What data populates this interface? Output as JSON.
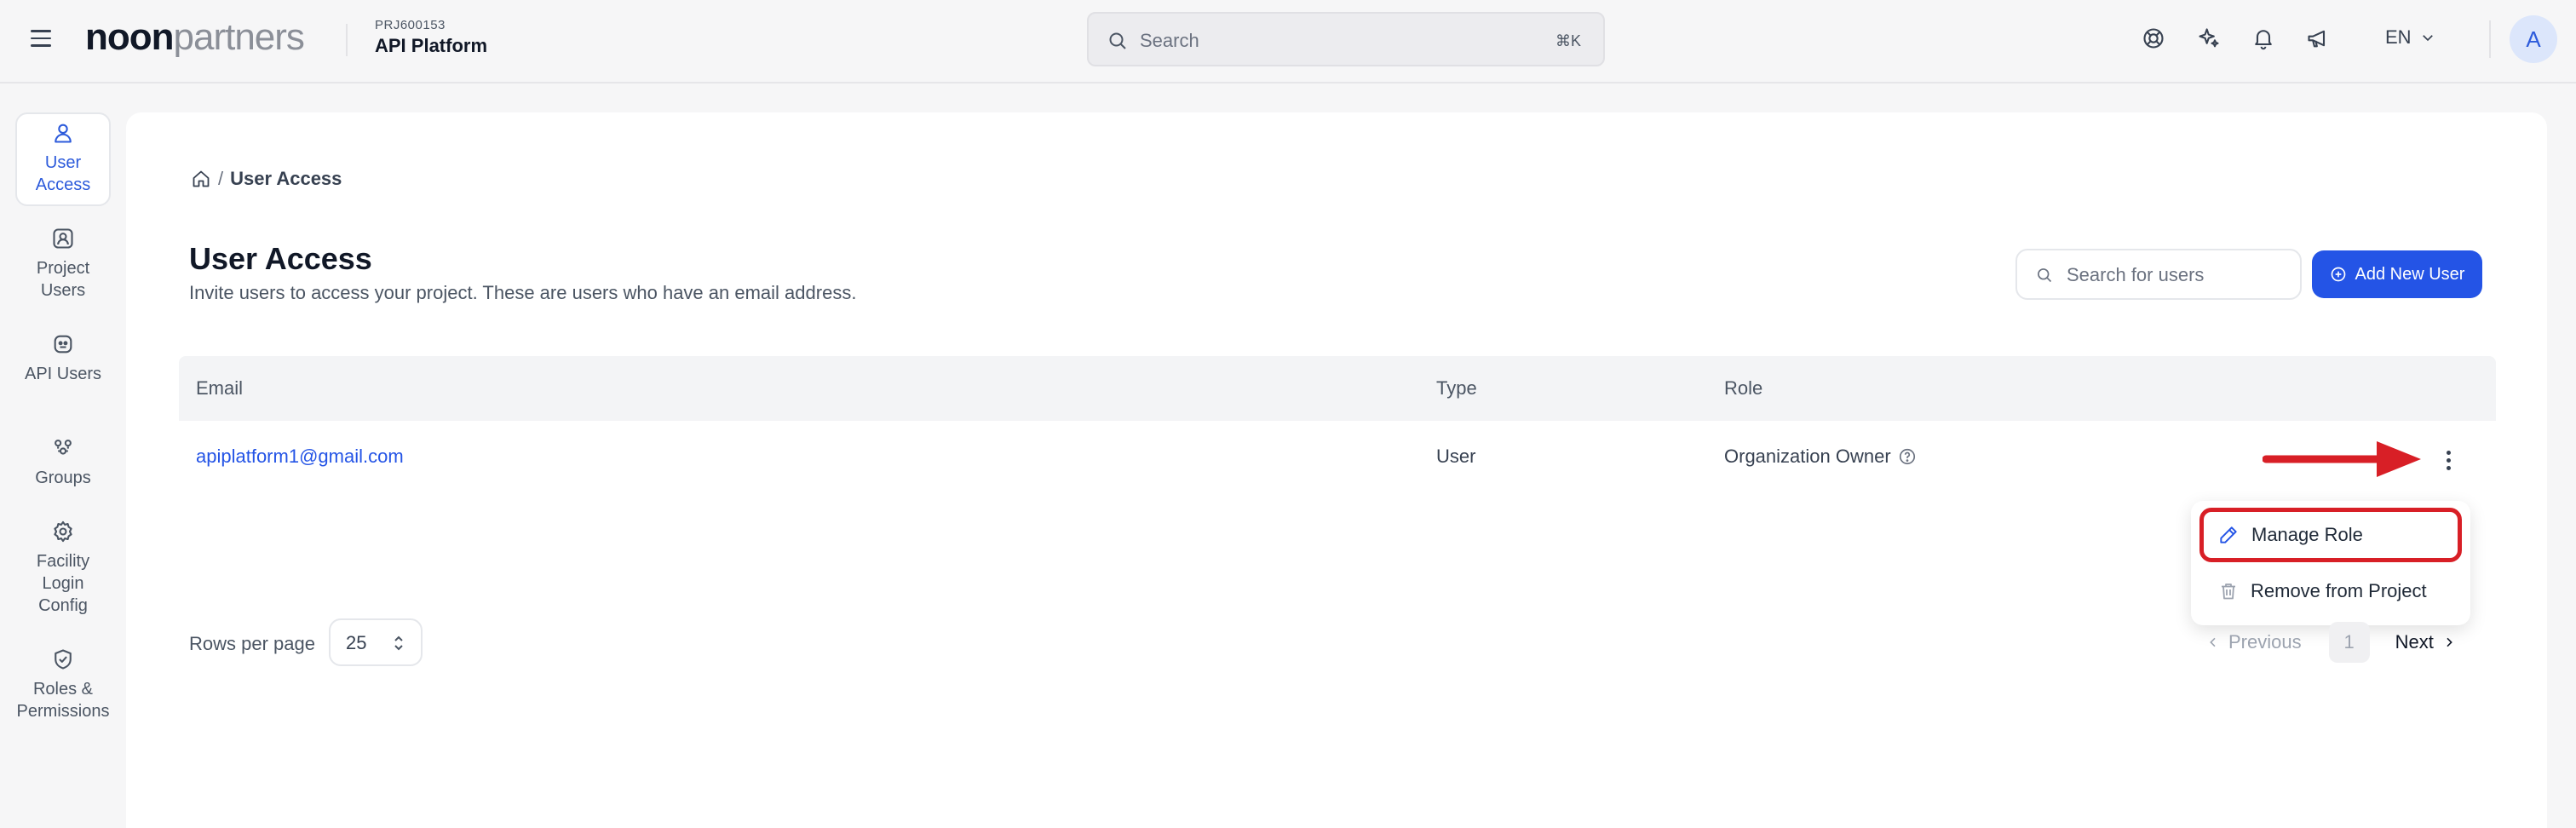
{
  "header": {
    "logo_noon": "noon",
    "logo_partners": "partners",
    "project_id": "PRJ600153",
    "project_name": "API Platform",
    "search_placeholder": "Search",
    "search_shortcut": "⌘K",
    "language": "EN",
    "avatar_initial": "A",
    "icons": [
      "hamburger-icon",
      "help-lifebuoy-icon",
      "ai-sparkles-icon",
      "bell-icon",
      "megaphone-icon",
      "chevron-down-icon",
      "search-icon"
    ]
  },
  "sidebar": {
    "items": [
      {
        "label": "User Access",
        "icon": "user-icon",
        "active": true
      },
      {
        "label": "Project Users",
        "icon": "user-badge-icon"
      },
      {
        "label": "API Users",
        "icon": "api-bot-icon"
      },
      {
        "label": "Groups",
        "icon": "groups-icon"
      },
      {
        "label": "Facility Login Config",
        "icon": "gear-icon"
      },
      {
        "label": "Roles & Permissions",
        "icon": "shield-check-icon"
      }
    ]
  },
  "breadcrumb": {
    "separator": "/",
    "current": "User Access"
  },
  "page": {
    "title": "User Access",
    "subtitle": "Invite users to access your project. These are users who have an email address.",
    "search_placeholder": "Search for users",
    "add_button": "Add New User"
  },
  "table": {
    "columns": [
      "Email",
      "Type",
      "Role"
    ],
    "rows": [
      {
        "email": "apiplatform1@gmail.com",
        "type": "User",
        "role": "Organization Owner"
      }
    ]
  },
  "row_menu": {
    "items": [
      {
        "label": "Manage Role",
        "icon": "pencil-icon"
      },
      {
        "label": "Remove from Project",
        "icon": "trash-icon"
      }
    ]
  },
  "pagination": {
    "rows_per_page_label": "Rows per page",
    "rows_per_page_value": "25",
    "previous": "Previous",
    "current_page": "1",
    "next": "Next"
  },
  "colors": {
    "accent": "#2454e6",
    "annotation_red": "#d81f26"
  }
}
